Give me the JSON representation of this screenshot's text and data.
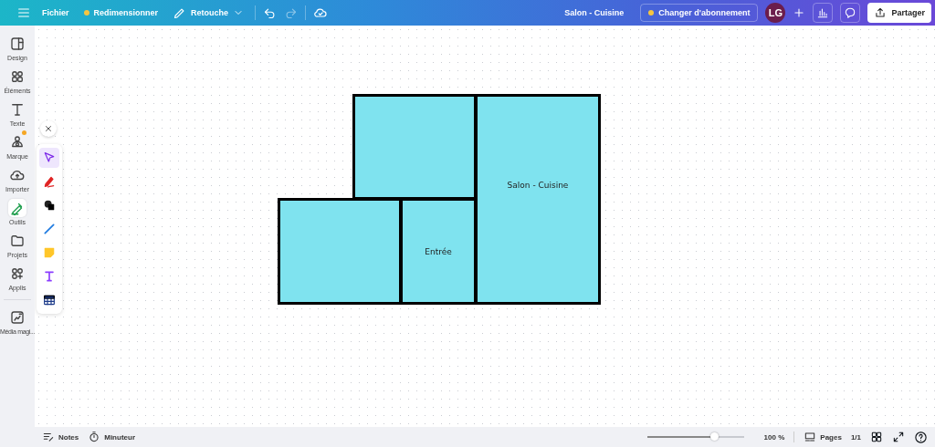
{
  "topbar": {
    "menu": "Fichier",
    "resize": "Redimensionner",
    "edit": "Retouche",
    "doc_title": "Salon - Cuisine",
    "upgrade": "Changer d'abonnement",
    "avatar": "LG",
    "share": "Partager"
  },
  "sidebar": {
    "items": [
      {
        "label": "Design",
        "selected": false,
        "badge": false
      },
      {
        "label": "Éléments",
        "selected": false,
        "badge": false
      },
      {
        "label": "Texte",
        "selected": false,
        "badge": false
      },
      {
        "label": "Marque",
        "selected": false,
        "badge": true
      },
      {
        "label": "Importer",
        "selected": false,
        "badge": false
      },
      {
        "label": "Outils",
        "selected": true,
        "badge": false
      },
      {
        "label": "Projets",
        "selected": false,
        "badge": false
      },
      {
        "label": "Applis",
        "selected": false,
        "badge": false
      }
    ],
    "bottom_item": {
      "label": "Média magi..."
    }
  },
  "tools": [
    {
      "kind": "select",
      "selected": true
    },
    {
      "kind": "pen",
      "selected": false
    },
    {
      "kind": "shapes",
      "selected": false
    },
    {
      "kind": "line",
      "selected": false
    },
    {
      "kind": "sticky",
      "selected": false
    },
    {
      "kind": "text",
      "selected": false
    },
    {
      "kind": "table",
      "selected": false
    }
  ],
  "rooms": [
    {
      "kind": "room"
    },
    {
      "kind": "room",
      "label": "Salon - Cuisine"
    },
    {
      "kind": "room"
    },
    {
      "kind": "room",
      "label": "Entrée"
    }
  ],
  "footer": {
    "notes": "Notes",
    "timer": "Minuteur",
    "zoom_slider": {
      "level": 0.7
    },
    "zoom": "100 %",
    "pages": "Pages",
    "page_count": "1/1"
  }
}
